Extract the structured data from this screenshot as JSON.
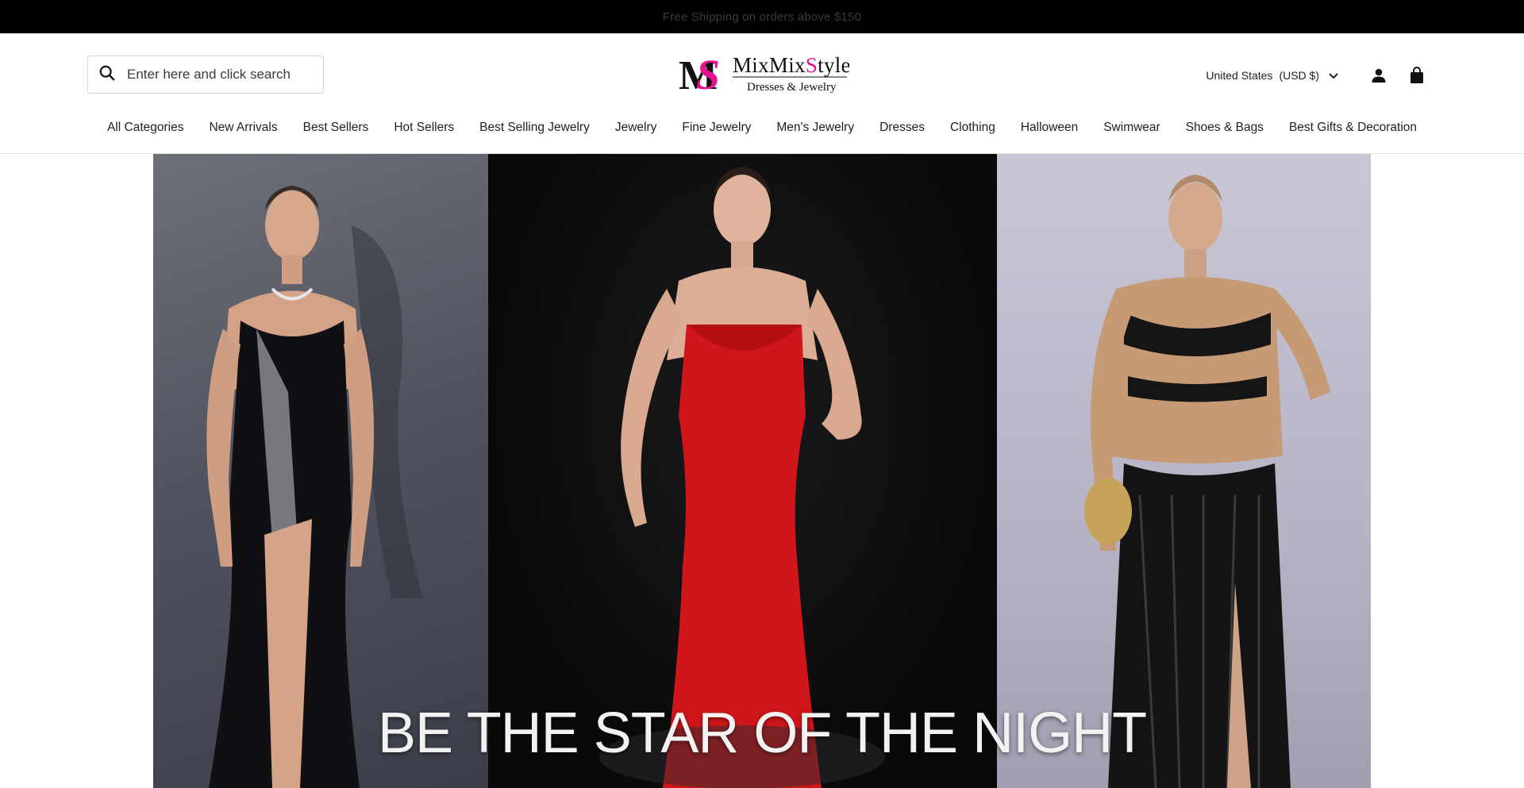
{
  "announcement": {
    "text": "Free Shipping on orders above $150"
  },
  "search": {
    "placeholder": "Enter here and click search"
  },
  "logo": {
    "monogram": "MS",
    "name": "MixMixStyle",
    "tagline": "Dresses & Jewelry"
  },
  "locale": {
    "country": "United States",
    "currency": "(USD $)"
  },
  "icons": {
    "search": "search-icon",
    "account": "user-icon",
    "cart": "shopping-bag-icon",
    "dropdown": "chevron-down-icon"
  },
  "nav": {
    "items": [
      {
        "label": "All Categories"
      },
      {
        "label": "New Arrivals"
      },
      {
        "label": "Best Sellers"
      },
      {
        "label": "Hot Sellers"
      },
      {
        "label": "Best Selling Jewelry"
      },
      {
        "label": "Jewelry"
      },
      {
        "label": "Fine Jewelry"
      },
      {
        "label": "Men's Jewelry"
      },
      {
        "label": "Dresses"
      },
      {
        "label": "Clothing"
      },
      {
        "label": "Halloween"
      },
      {
        "label": "Swimwear"
      },
      {
        "label": "Shoes & Bags"
      },
      {
        "label": "Best Gifts & Decoration"
      }
    ]
  },
  "hero": {
    "headline": "BE THE STAR OF THE NIGHT"
  },
  "colors": {
    "announce_bg": "#000000",
    "brand_pink": "#e6138e",
    "text": "#222222",
    "red_dress": "#d1161b"
  }
}
